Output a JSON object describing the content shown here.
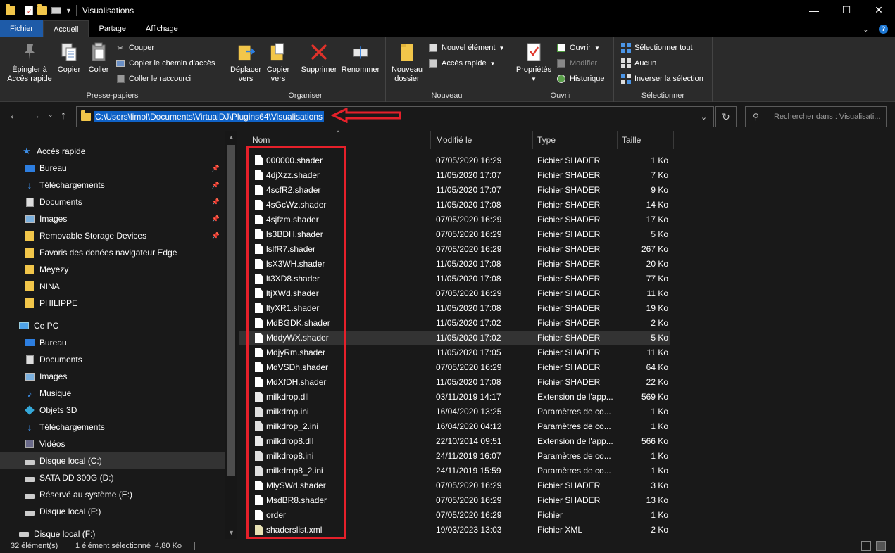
{
  "window": {
    "title": "Visualisations",
    "controls": [
      "—",
      "☐",
      "✕"
    ]
  },
  "ribbon_tabs": [
    "Fichier",
    "Accueil",
    "Partage",
    "Affichage"
  ],
  "ribbon": {
    "clipboard": {
      "label": "Presse-papiers",
      "pin": "Épingler à\nAccès rapide",
      "copy": "Copier",
      "paste": "Coller",
      "cut": "Couper",
      "copy_path": "Copier le chemin d'accès",
      "paste_shortcut": "Coller le raccourci"
    },
    "organize": {
      "label": "Organiser",
      "move": "Déplacer\nvers",
      "copy_to": "Copier\nvers",
      "delete": "Supprimer",
      "rename": "Renommer"
    },
    "new": {
      "label": "Nouveau",
      "new_folder": "Nouveau\ndossier",
      "new_item": "Nouvel élément",
      "easy_access": "Accès rapide"
    },
    "open": {
      "label": "Ouvrir",
      "properties": "Propriétés",
      "open": "Ouvrir",
      "edit": "Modifier",
      "history": "Historique"
    },
    "select": {
      "label": "Sélectionner",
      "select_all": "Sélectionner tout",
      "select_none": "Aucun",
      "invert": "Inverser la sélection"
    }
  },
  "address": {
    "path": "C:\\Users\\limol\\Documents\\VirtualDJ\\Plugins64\\Visualisations",
    "search_placeholder": "Rechercher dans : Visualisati..."
  },
  "nav": {
    "quick_access": "Accès rapide",
    "quick_items": [
      {
        "label": "Bureau",
        "icon": "desktop-icon",
        "pinned": true
      },
      {
        "label": "Téléchargements",
        "icon": "download-icon",
        "pinned": true
      },
      {
        "label": "Documents",
        "icon": "documents-icon",
        "pinned": true
      },
      {
        "label": "Images",
        "icon": "images-icon",
        "pinned": true
      },
      {
        "label": "Removable Storage Devices",
        "icon": "folder-icon",
        "pinned": true
      },
      {
        "label": "Favoris des donées navigateur Edge",
        "icon": "folder-icon",
        "pinned": false
      },
      {
        "label": "Meyezy",
        "icon": "folder-icon",
        "pinned": false
      },
      {
        "label": "NINA",
        "icon": "folder-icon",
        "pinned": false
      },
      {
        "label": "PHILIPPE",
        "icon": "folder-icon",
        "pinned": false
      }
    ],
    "this_pc": "Ce PC",
    "pc_items": [
      {
        "label": "Bureau",
        "icon": "desktop-icon"
      },
      {
        "label": "Documents",
        "icon": "documents-icon"
      },
      {
        "label": "Images",
        "icon": "images-icon"
      },
      {
        "label": "Musique",
        "icon": "music-icon"
      },
      {
        "label": "Objets 3D",
        "icon": "cube-icon"
      },
      {
        "label": "Téléchargements",
        "icon": "download-icon"
      },
      {
        "label": "Vidéos",
        "icon": "video-icon"
      },
      {
        "label": "Disque local (C:)",
        "icon": "drive-icon"
      },
      {
        "label": "SATA DD 300G (D:)",
        "icon": "drive-icon"
      },
      {
        "label": "Réservé au système (E:)",
        "icon": "drive-icon"
      },
      {
        "label": "Disque local (F:)",
        "icon": "drive-icon"
      }
    ],
    "bottom_item": "Disque local (F:)"
  },
  "columns": [
    "Nom",
    "Modifié le",
    "Type",
    "Taille"
  ],
  "files": [
    {
      "name": "000000.shader",
      "date": "07/05/2020 16:29",
      "type": "Fichier SHADER",
      "size": "1 Ko",
      "kind": "shader"
    },
    {
      "name": "4djXzz.shader",
      "date": "11/05/2020 17:07",
      "type": "Fichier SHADER",
      "size": "7 Ko",
      "kind": "shader"
    },
    {
      "name": "4scfR2.shader",
      "date": "11/05/2020 17:07",
      "type": "Fichier SHADER",
      "size": "9 Ko",
      "kind": "shader"
    },
    {
      "name": "4sGcWz.shader",
      "date": "11/05/2020 17:08",
      "type": "Fichier SHADER",
      "size": "14 Ko",
      "kind": "shader"
    },
    {
      "name": "4sjfzm.shader",
      "date": "07/05/2020 16:29",
      "type": "Fichier SHADER",
      "size": "17 Ko",
      "kind": "shader"
    },
    {
      "name": "ls3BDH.shader",
      "date": "07/05/2020 16:29",
      "type": "Fichier SHADER",
      "size": "5 Ko",
      "kind": "shader"
    },
    {
      "name": "lslfR7.shader",
      "date": "07/05/2020 16:29",
      "type": "Fichier SHADER",
      "size": "267 Ko",
      "kind": "shader"
    },
    {
      "name": "lsX3WH.shader",
      "date": "11/05/2020 17:08",
      "type": "Fichier SHADER",
      "size": "20 Ko",
      "kind": "shader"
    },
    {
      "name": "lt3XD8.shader",
      "date": "11/05/2020 17:08",
      "type": "Fichier SHADER",
      "size": "77 Ko",
      "kind": "shader"
    },
    {
      "name": "ltjXWd.shader",
      "date": "07/05/2020 16:29",
      "type": "Fichier SHADER",
      "size": "11 Ko",
      "kind": "shader"
    },
    {
      "name": "ltyXR1.shader",
      "date": "11/05/2020 17:08",
      "type": "Fichier SHADER",
      "size": "19 Ko",
      "kind": "shader"
    },
    {
      "name": "MdBGDK.shader",
      "date": "11/05/2020 17:02",
      "type": "Fichier SHADER",
      "size": "2 Ko",
      "kind": "shader"
    },
    {
      "name": "MddyWX.shader",
      "date": "11/05/2020 17:02",
      "type": "Fichier SHADER",
      "size": "5 Ko",
      "kind": "shader",
      "selected": true
    },
    {
      "name": "MdjyRm.shader",
      "date": "11/05/2020 17:05",
      "type": "Fichier SHADER",
      "size": "11 Ko",
      "kind": "shader"
    },
    {
      "name": "MdVSDh.shader",
      "date": "07/05/2020 16:29",
      "type": "Fichier SHADER",
      "size": "64 Ko",
      "kind": "shader"
    },
    {
      "name": "MdXfDH.shader",
      "date": "11/05/2020 17:08",
      "type": "Fichier SHADER",
      "size": "22 Ko",
      "kind": "shader"
    },
    {
      "name": "milkdrop.dll",
      "date": "03/11/2019 14:17",
      "type": "Extension de l'app...",
      "size": "569 Ko",
      "kind": "dll"
    },
    {
      "name": "milkdrop.ini",
      "date": "16/04/2020 13:25",
      "type": "Paramètres de co...",
      "size": "1 Ko",
      "kind": "ini"
    },
    {
      "name": "milkdrop_2.ini",
      "date": "16/04/2020 04:12",
      "type": "Paramètres de co...",
      "size": "1 Ko",
      "kind": "ini"
    },
    {
      "name": "milkdrop8.dll",
      "date": "22/10/2014 09:51",
      "type": "Extension de l'app...",
      "size": "566 Ko",
      "kind": "dll"
    },
    {
      "name": "milkdrop8.ini",
      "date": "24/11/2019 16:07",
      "type": "Paramètres de co...",
      "size": "1 Ko",
      "kind": "ini"
    },
    {
      "name": "milkdrop8_2.ini",
      "date": "24/11/2019 15:59",
      "type": "Paramètres de co...",
      "size": "1 Ko",
      "kind": "ini"
    },
    {
      "name": "MlySWd.shader",
      "date": "07/05/2020 16:29",
      "type": "Fichier SHADER",
      "size": "3 Ko",
      "kind": "shader"
    },
    {
      "name": "MsdBR8.shader",
      "date": "07/05/2020 16:29",
      "type": "Fichier SHADER",
      "size": "13 Ko",
      "kind": "shader"
    },
    {
      "name": "order",
      "date": "07/05/2020 16:29",
      "type": "Fichier",
      "size": "1 Ko",
      "kind": "file"
    },
    {
      "name": "shaderslist.xml",
      "date": "19/03/2023 13:03",
      "type": "Fichier XML",
      "size": "2 Ko",
      "kind": "xml"
    }
  ],
  "status": {
    "count": "32 élément(s)",
    "selection": "1 élément sélectionné  4,80 Ko"
  },
  "colors": {
    "accent": "#1e5ba8",
    "selection": "#0f62c7",
    "annotation": "#e5202a"
  }
}
